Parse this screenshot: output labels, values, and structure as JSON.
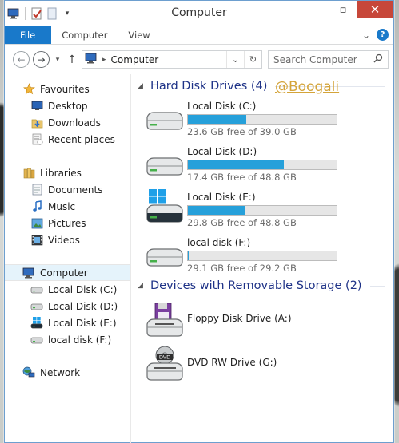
{
  "window": {
    "title": "Computer"
  },
  "ribbon": {
    "tabs": [
      "File",
      "Computer",
      "View"
    ]
  },
  "address": {
    "location": "Computer",
    "search_placeholder": "Search Computer"
  },
  "navigation": {
    "favourites": {
      "label": "Favourites",
      "items": [
        "Desktop",
        "Downloads",
        "Recent places"
      ]
    },
    "libraries": {
      "label": "Libraries",
      "items": [
        "Documents",
        "Music",
        "Pictures",
        "Videos"
      ]
    },
    "computer": {
      "label": "Computer",
      "items": [
        "Local Disk (C:)",
        "Local Disk (D:)",
        "Local Disk (E:)",
        "local disk (F:)"
      ]
    },
    "network": {
      "label": "Network"
    }
  },
  "content": {
    "hard_disk_header": "Hard Disk Drives (4)",
    "removable_header": "Devices with Removable Storage (2)",
    "drives": [
      {
        "name": "Local Disk (C:)",
        "free": "23.6 GB free of 39.0 GB",
        "used_fraction": 0.395,
        "icon": "hdd-icon"
      },
      {
        "name": "Local Disk (D:)",
        "free": "17.4 GB free of 48.8 GB",
        "used_fraction": 0.643,
        "icon": "hdd-icon"
      },
      {
        "name": "Local Disk (E:)",
        "free": "29.8 GB free of 48.8 GB",
        "used_fraction": 0.389,
        "icon": "windows-hdd-icon"
      },
      {
        "name": "local disk (F:)",
        "free": "29.1 GB free of 29.2 GB",
        "used_fraction": 0.003,
        "icon": "hdd-icon"
      }
    ],
    "devices": [
      {
        "name": "Floppy Disk Drive (A:)",
        "icon": "floppy-drive-icon"
      },
      {
        "name": "DVD RW Drive (G:)",
        "icon": "dvd-drive-icon"
      }
    ],
    "watermark": "@Boogali"
  },
  "colors": {
    "accent": "#1979ca",
    "bar_fill": "#26a0da",
    "group_header": "#1e3287",
    "close": "#c7473a"
  }
}
